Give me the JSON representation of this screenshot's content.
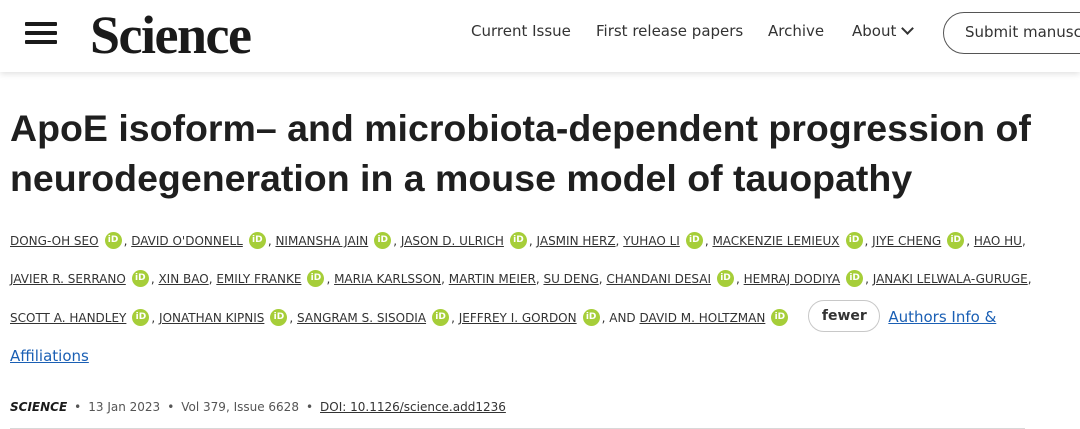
{
  "header": {
    "logo": "Science",
    "nav": [
      "Current Issue",
      "First release papers",
      "Archive",
      "About"
    ],
    "submit_label": "Submit manuscript"
  },
  "article": {
    "title": "ApoE isoform– and microbiota-dependent progression of neurodegeneration in a mouse model of tauopathy",
    "authors": [
      {
        "name": "DONG-OH SEO",
        "orcid": true
      },
      {
        "name": "DAVID O'DONNELL",
        "orcid": true
      },
      {
        "name": "NIMANSHA JAIN",
        "orcid": true
      },
      {
        "name": "JASON D. ULRICH",
        "orcid": true
      },
      {
        "name": "JASMIN HERZ",
        "orcid": false
      },
      {
        "name": "YUHAO LI",
        "orcid": true
      },
      {
        "name": "MACKENZIE LEMIEUX",
        "orcid": true
      },
      {
        "name": "JIYE CHENG",
        "orcid": true
      },
      {
        "name": "HAO HU",
        "orcid": false
      },
      {
        "name": "JAVIER R. SERRANO",
        "orcid": true
      },
      {
        "name": "XIN BAO",
        "orcid": false
      },
      {
        "name": "EMILY FRANKE",
        "orcid": true
      },
      {
        "name": "MARIA KARLSSON",
        "orcid": false
      },
      {
        "name": "MARTIN MEIER",
        "orcid": false
      },
      {
        "name": "SU DENG",
        "orcid": false
      },
      {
        "name": "CHANDANI DESAI",
        "orcid": true
      },
      {
        "name": "HEMRAJ DODIYA",
        "orcid": true
      },
      {
        "name": "JANAKI LELWALA-GURUGE",
        "orcid": false
      },
      {
        "name": "SCOTT A. HANDLEY",
        "orcid": true
      },
      {
        "name": "JONATHAN KIPNIS",
        "orcid": true
      },
      {
        "name": "SANGRAM S. SISODIA",
        "orcid": true
      },
      {
        "name": "JEFFREY I. GORDON",
        "orcid": true
      },
      {
        "name": "DAVID M. HOLTZMAN",
        "orcid": true
      }
    ],
    "and_label": "AND",
    "orcid_label": "iD",
    "fewer_label": "fewer",
    "affiliations_label": "Authors Info & Affiliations",
    "journal": "SCIENCE",
    "date": "13 Jan 2023",
    "volume_issue": "Vol 379, Issue 6628",
    "doi": "DOI: 10.1126/science.add1236"
  },
  "colors": {
    "orcid_green": "#a6ce39",
    "link_blue": "#1a5fb4",
    "text": "#1a1a1a"
  }
}
